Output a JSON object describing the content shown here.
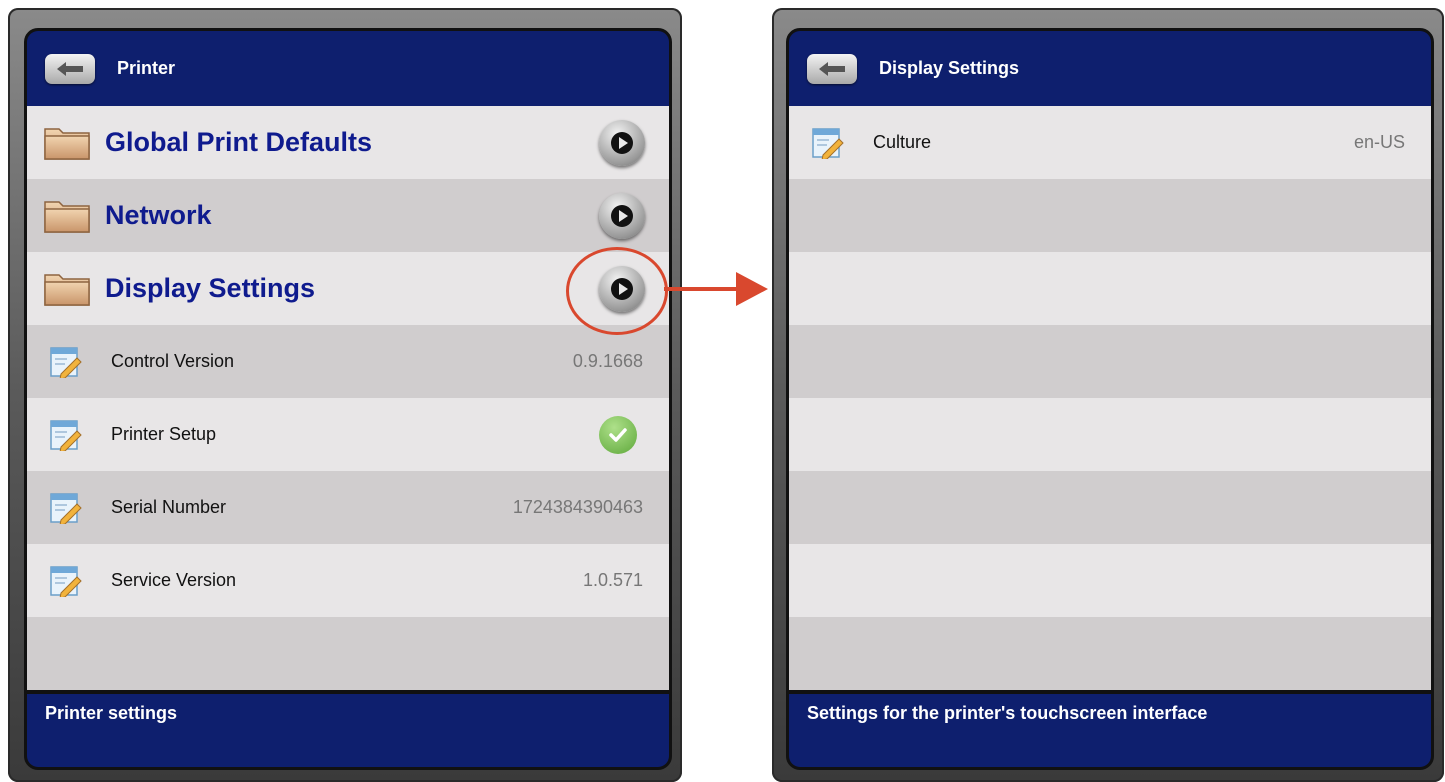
{
  "left_screen": {
    "header_title": "Printer",
    "rows": [
      {
        "type": "folder",
        "label": "Global Print Defaults"
      },
      {
        "type": "folder",
        "label": "Network"
      },
      {
        "type": "folder",
        "label": "Display Settings"
      },
      {
        "type": "setting",
        "label": "Control Version",
        "value": "0.9.1668"
      },
      {
        "type": "setting",
        "label": "Printer Setup",
        "status": "ok"
      },
      {
        "type": "setting",
        "label": "Serial Number",
        "value": "1724384390463"
      },
      {
        "type": "setting",
        "label": "Service Version",
        "value": "1.0.571"
      }
    ],
    "footer_text": "Printer settings"
  },
  "right_screen": {
    "header_title": "Display Settings",
    "rows": [
      {
        "type": "setting",
        "label": "Culture",
        "value": "en-US"
      }
    ],
    "footer_text": "Settings for the printer's touchscreen interface"
  },
  "annotation": {
    "highlight_color": "#d9482e"
  },
  "colors": {
    "header_bg": "#0e1f6e",
    "folder_label": "#0f1b8e",
    "row_light": "#e8e6e7",
    "row_dark": "#d0cdce"
  },
  "icons": {
    "back": "back-arrow-icon",
    "folder": "folder-icon",
    "setting": "edit-document-icon",
    "navigate": "play-arrow-icon",
    "status_ok": "checkmark-icon"
  }
}
